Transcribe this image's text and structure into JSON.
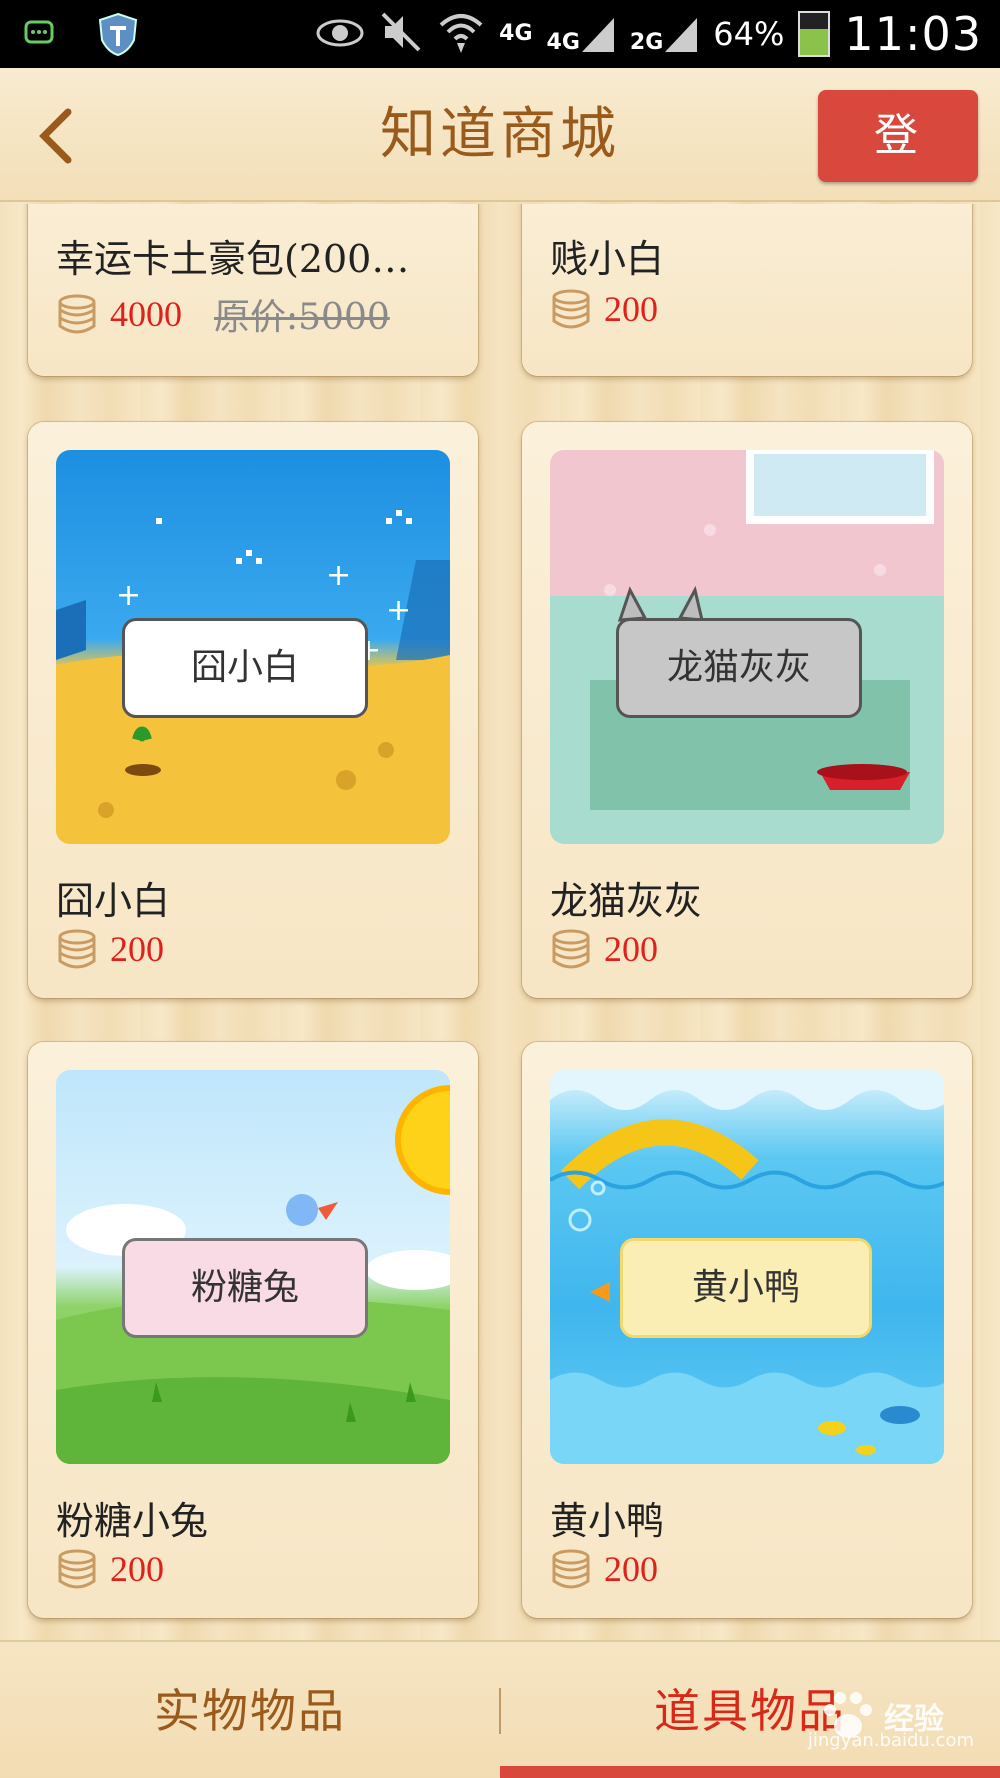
{
  "status_bar": {
    "network1": "4G",
    "network2": "4G",
    "network3": "2G",
    "battery": "64%",
    "time": "11:03"
  },
  "header": {
    "title": "知道商城",
    "login_label": "登 录"
  },
  "products": [
    {
      "name": "幸运卡土豪包(200…",
      "price": "4000",
      "original_price": "原价:5000"
    },
    {
      "name": "贱小白",
      "price": "200"
    },
    {
      "name": "囧小白",
      "price": "200",
      "thumb_label": "囧小白"
    },
    {
      "name": "龙猫灰灰",
      "price": "200",
      "thumb_label": "龙猫灰灰"
    },
    {
      "name": "粉糖小兔",
      "price": "200",
      "thumb_label": "粉糖兔"
    },
    {
      "name": "黄小鸭",
      "price": "200",
      "thumb_label": "黄小鸭"
    }
  ],
  "tabs": [
    {
      "label": "实物物品"
    },
    {
      "label": "道具物品"
    }
  ],
  "watermark": {
    "text": "经验",
    "url": "jingyan.baidu.com"
  },
  "colors": {
    "accent": "#d9483c",
    "price": "#e0201a",
    "title": "#9a5a1c"
  }
}
